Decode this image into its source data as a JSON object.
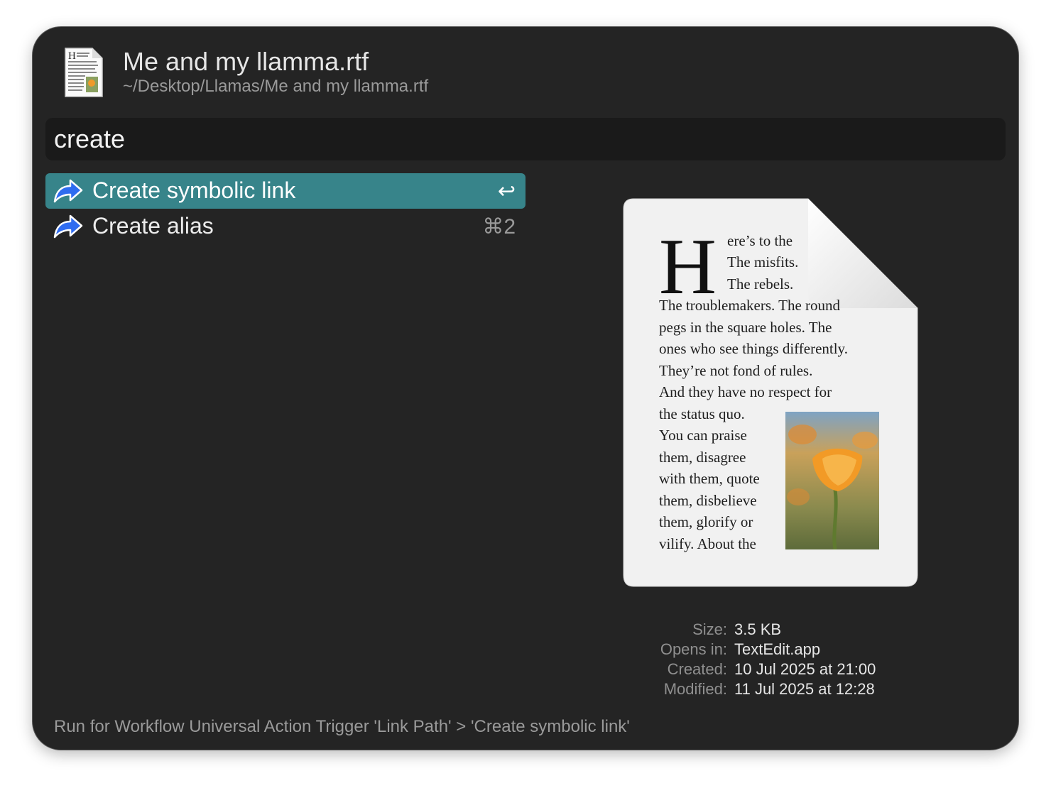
{
  "file": {
    "name": "Me and my llamma.rtf",
    "path": "~/Desktop/Llamas/Me and my llamma.rtf",
    "icon": "rtf-document-icon"
  },
  "search": {
    "value": "create",
    "placeholder": ""
  },
  "actions": [
    {
      "label": "Create symbolic link",
      "shortcut": "↩",
      "icon": "share-arrow-icon",
      "selected": true
    },
    {
      "label": "Create alias",
      "shortcut": "⌘2",
      "icon": "share-arrow-icon",
      "selected": false
    }
  ],
  "preview": {
    "drop_cap": "H",
    "lines": [
      "ere’s to the",
      "The misfits.",
      "The rebels.",
      "The troublemakers. The round",
      "pegs in the square holes. The",
      "ones who see things differently.",
      "They’re not fond of rules.",
      "And they have no respect for",
      "the status quo.",
      "You can praise",
      "them, disagree",
      "with them, quote",
      "them, disbelieve",
      "them, glorify or",
      "vilify. About the"
    ]
  },
  "metadata": [
    {
      "key": "Size:",
      "value": "3.5 KB"
    },
    {
      "key": "Opens in:",
      "value": "TextEdit.app"
    },
    {
      "key": "Created:",
      "value": "10 Jul 2025 at 21:00"
    },
    {
      "key": "Modified:",
      "value": "11 Jul 2025 at 12:28"
    }
  ],
  "footer": "Run for Workflow Universal Action Trigger 'Link Path' > 'Create symbolic link'",
  "colors": {
    "window_bg": "#242424",
    "search_bg": "#1a1a1a",
    "selection": "#37848a",
    "icon_blue": "#2f6cf0"
  }
}
